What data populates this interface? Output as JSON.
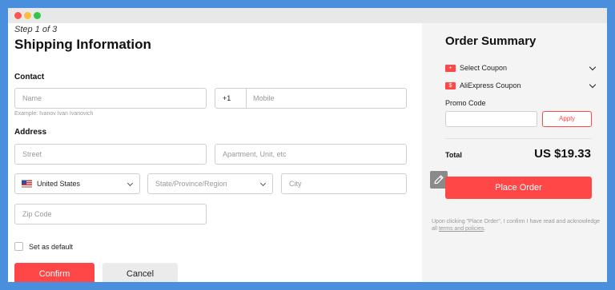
{
  "shipping": {
    "step": "Step 1 of 3",
    "title": "Shipping Information",
    "contact_heading": "Contact",
    "name_placeholder": "Name",
    "phone_code": "+1",
    "mobile_placeholder": "Mobile",
    "name_example": "Example: Ivanov Ivan Ivanovich",
    "address_heading": "Address",
    "street_placeholder": "Street",
    "apartment_placeholder": "Apartment, Unit, etc",
    "country_value": "United States",
    "state_placeholder": "State/Province/Region",
    "city_placeholder": "City",
    "zip_placeholder": "Zip Code",
    "default_label": "Set as default",
    "confirm_label": "Confirm",
    "cancel_label": "Cancel"
  },
  "summary": {
    "title": "Order Summary",
    "coupons": [
      {
        "label": "Select Coupon",
        "icon": "coupon-icon"
      },
      {
        "label": "AliExpress Coupon",
        "icon": "aliexpress-coupon-icon"
      }
    ],
    "promo_label": "Promo Code",
    "apply_label": "Apply",
    "total_label": "Total",
    "total_value": "US $19.33",
    "place_order_label": "Place Order",
    "notice_text": "Upon clicking \"Place Order\", I confirm I have read and acknowledge all",
    "notice_link": "terms and policies",
    "notice_end": "."
  },
  "colors": {
    "accent": "#ff4747",
    "background": "#4a8fde"
  }
}
